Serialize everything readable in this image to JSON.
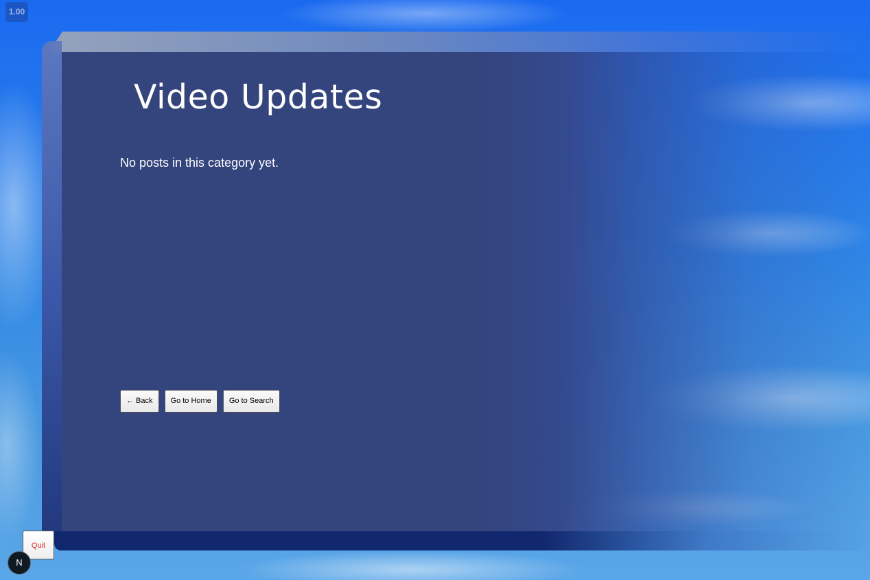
{
  "zoom_indicator": "1.00",
  "page": {
    "title": "Video Updates",
    "empty_message": "No posts in this category yet."
  },
  "nav": {
    "back_label": "← Back",
    "home_label": "Go to Home",
    "search_label": "Go to Search"
  },
  "quit_label": "Quit",
  "corner_logo_letter": "N",
  "colors": {
    "panel_face": "#34447d",
    "panel_bottom_edge": "#12286e",
    "sky": "#2f86e6",
    "quit_text": "#e0242b",
    "title_text": "#ffffff"
  }
}
